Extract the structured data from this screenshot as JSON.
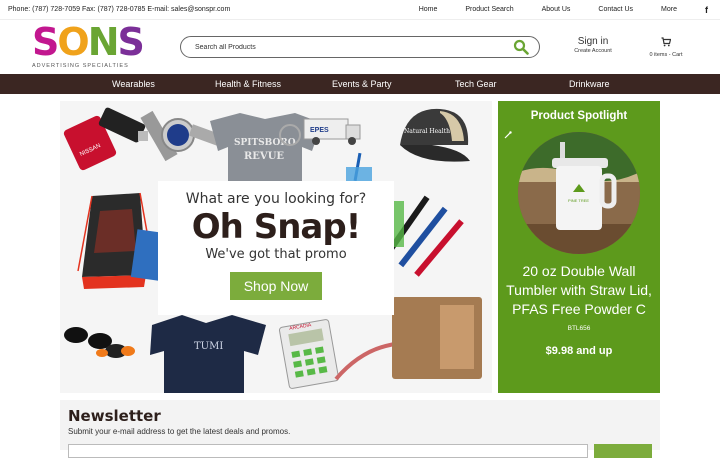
{
  "topbar": {
    "contact": "Phone: (787) 728-7059 Fax: (787) 728-0785 E-mail: sales@sonspr.com",
    "links": [
      "Home",
      "Product Search",
      "About Us",
      "Contact Us",
      "More"
    ],
    "facebook": "f"
  },
  "logo": {
    "letters": [
      "S",
      "O",
      "N",
      "S"
    ],
    "tagline": "ADVERTISING SPECIALTIES"
  },
  "search": {
    "placeholder": "Search all Products",
    "icon": "search-icon"
  },
  "account": {
    "signin": "Sign in",
    "create": "Create Account"
  },
  "cart": {
    "label": "0 items - Cart",
    "icon": "cart-icon"
  },
  "nav": {
    "items": [
      "Wearables",
      "Health & Fitness",
      "Events & Party",
      "Tech Gear",
      "Drinkware"
    ]
  },
  "hero": {
    "question": "What are you looking for?",
    "headline": "Oh Snap!",
    "subline": "We've got that promo",
    "button": "Shop Now",
    "product_texts": {
      "cap": "Natural Health",
      "truck": "EPES",
      "shirt": "REVUE",
      "tshirt": "TUMI",
      "calculator": "ARCADIA",
      "bag": "NISSAN"
    }
  },
  "spotlight": {
    "title": "Product Spotlight",
    "product_brand": "PINE TREE",
    "name": "20 oz Double Wall Tumbler with Straw Lid, PFAS Free Powder C",
    "sku": "BTL656",
    "price": "$9.98 and up"
  },
  "newsletter": {
    "title": "Newsletter",
    "description": "Submit your e-mail address to get the latest deals and promos."
  },
  "colors": {
    "nav_bg": "#3b2622",
    "accent_green": "#7cac3c",
    "spotlight_bg": "#5d9a1c"
  }
}
